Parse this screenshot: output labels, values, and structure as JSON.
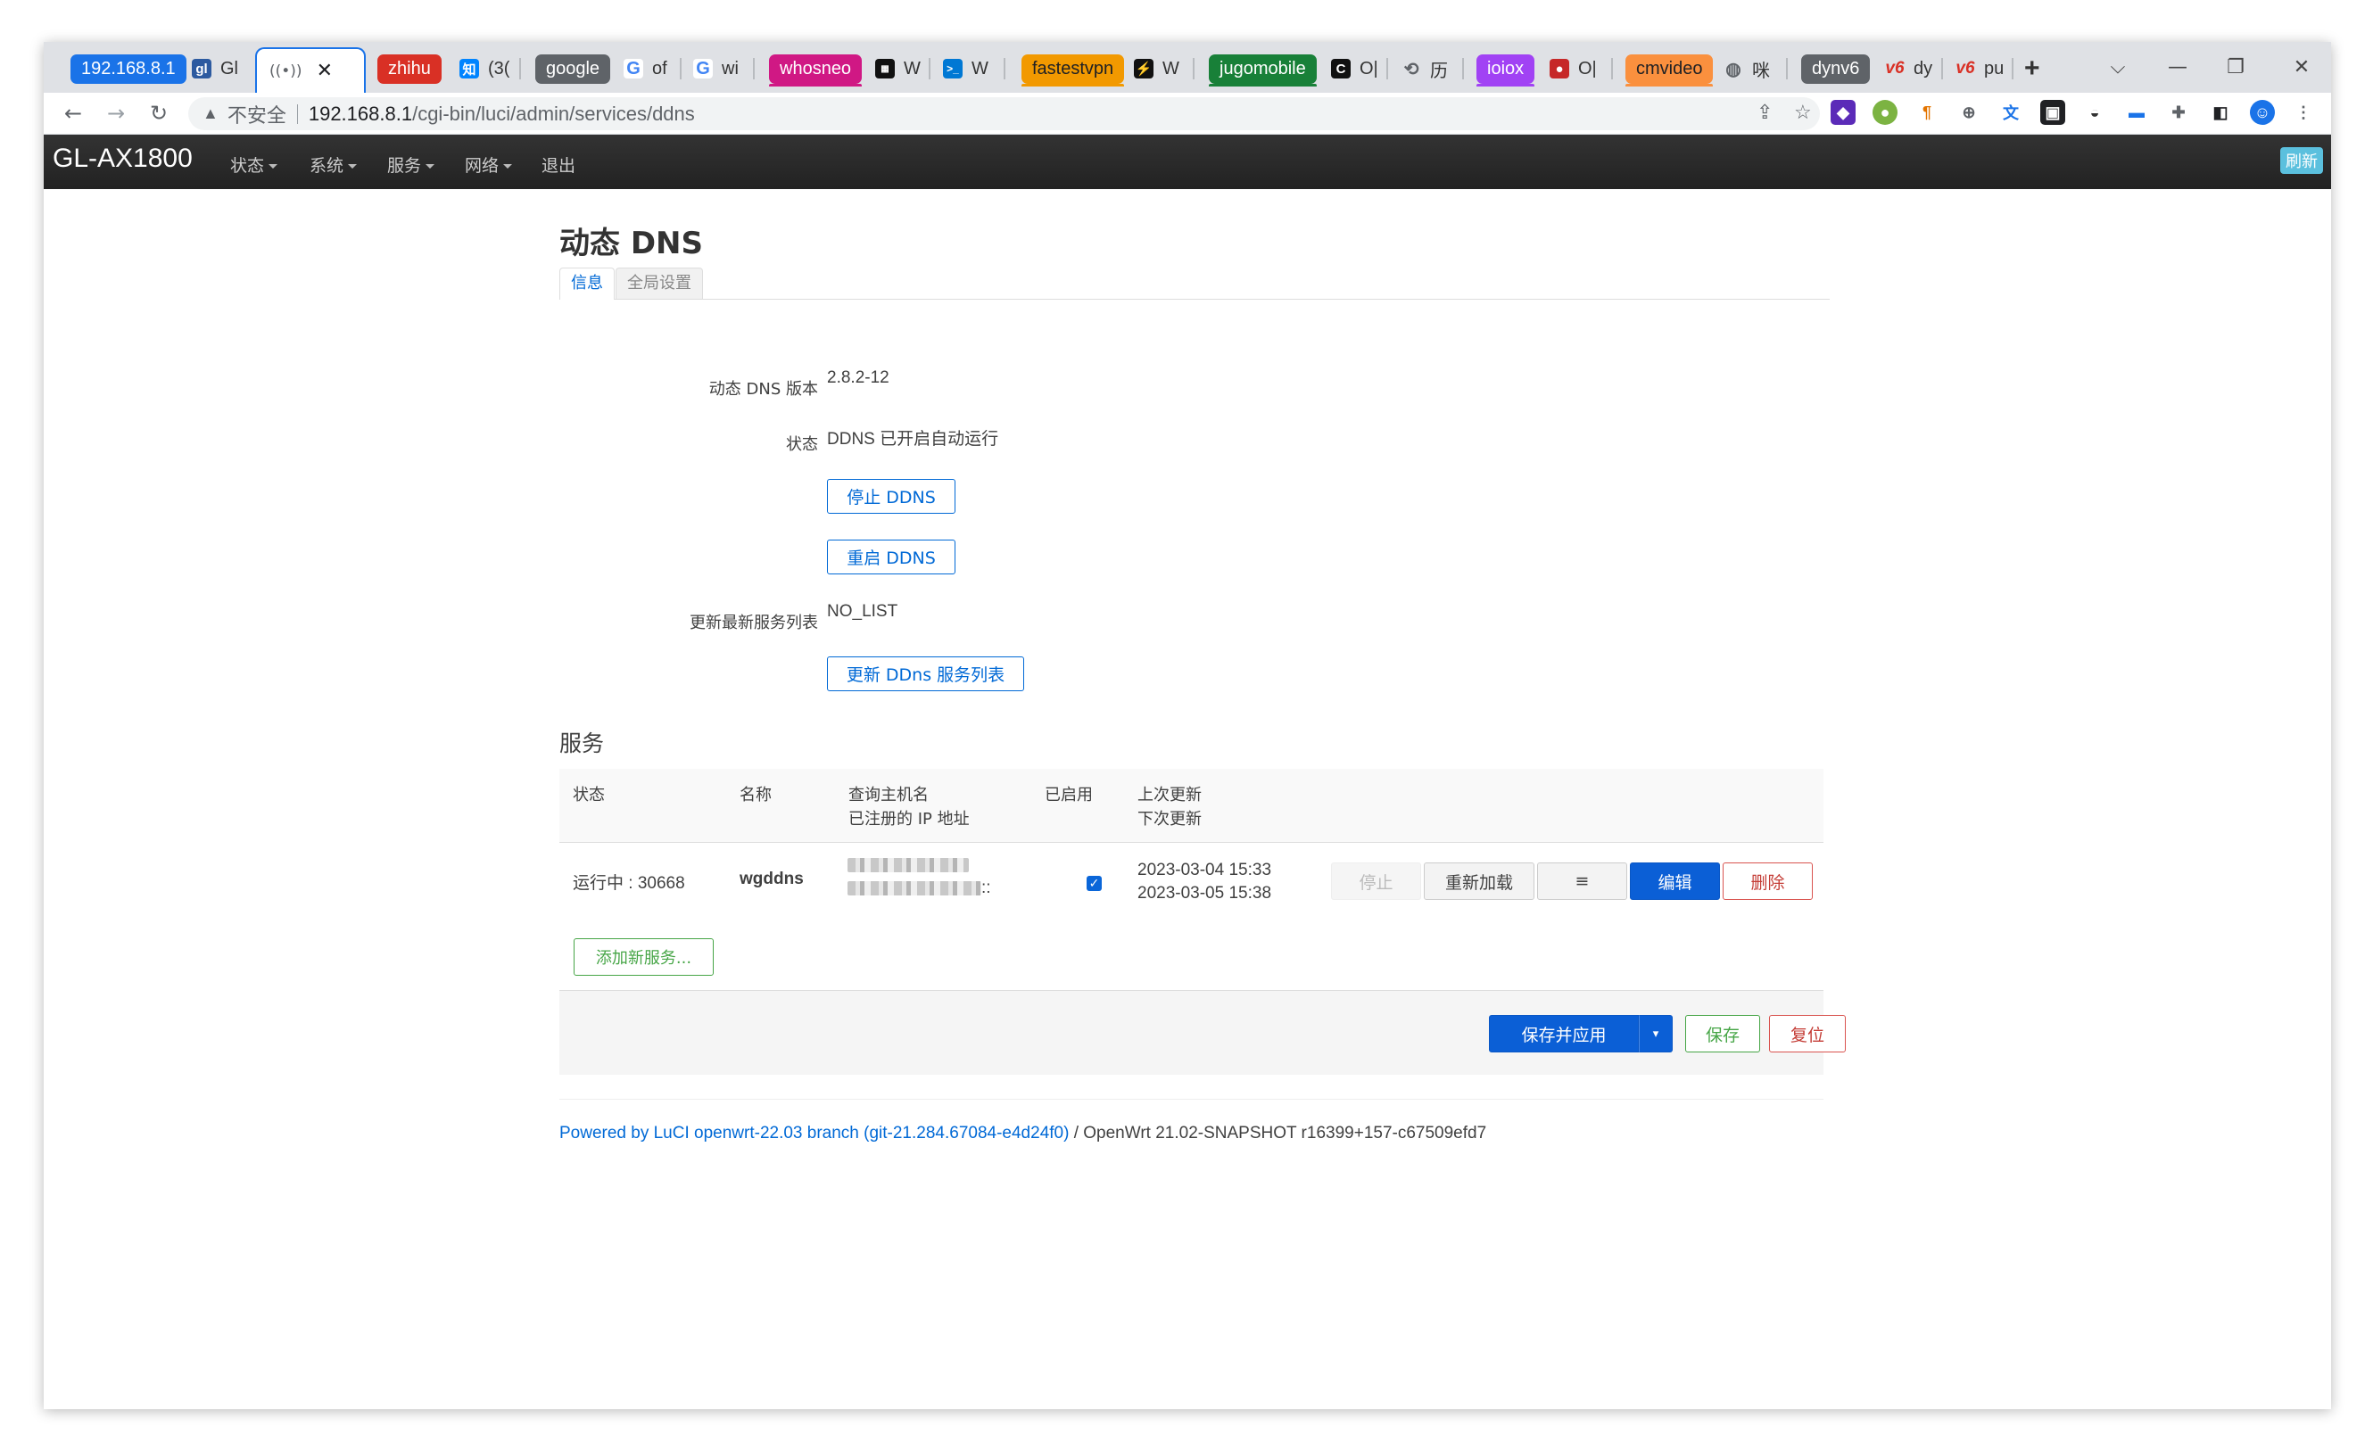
{
  "browser": {
    "tabs": [
      {
        "label": "192.168.8.1",
        "color": "#1a73e8"
      },
      {
        "label": "Gl",
        "favicon": "gl"
      },
      {
        "label": "",
        "favicon": "wifi",
        "active": true
      },
      {
        "label": "zhihu",
        "color": "#d93025"
      },
      {
        "label": "(3(",
        "favicon": "知"
      },
      {
        "label": "google",
        "color": "#5f6368"
      },
      {
        "label": "of",
        "favicon": "G"
      },
      {
        "label": "wi",
        "favicon": "G"
      },
      {
        "label": "whosneo",
        "color": "#d01884"
      },
      {
        "label": "W",
        "favicon": "white"
      },
      {
        "label": "W",
        "favicon": "terminal"
      },
      {
        "label": "fastestvpn",
        "color": "#f29900",
        "text_color": "#202124"
      },
      {
        "label": "W",
        "favicon": "bolt"
      },
      {
        "label": "jugomobile",
        "color": "#188038"
      },
      {
        "label": "O|",
        "favicon": "c"
      },
      {
        "label": "历",
        "favicon": "history"
      },
      {
        "label": "ioiox",
        "color": "#a142f4"
      },
      {
        "label": "O|",
        "favicon": "octo"
      },
      {
        "label": "cmvideo",
        "color": "#fa903e",
        "text_color": "#202124"
      },
      {
        "label": "咪",
        "favicon": "globe"
      },
      {
        "label": "dynv6",
        "color": "#5f6368"
      },
      {
        "label": "dy",
        "favicon": "v6"
      },
      {
        "label": "pu",
        "favicon": "v6"
      }
    ],
    "new_tab": "+",
    "address": {
      "warning": "不安全",
      "host": "192.168.8.1",
      "path": "/cgi-bin/luci/admin/services/ddns"
    }
  },
  "navbar": {
    "brand": "GL-AX1800",
    "menus": [
      "状态",
      "系统",
      "服务",
      "网络",
      "退出"
    ],
    "refresh": "刷新"
  },
  "page": {
    "title": "动态 DNS",
    "tabs": [
      "信息",
      "全局设置"
    ],
    "fields": {
      "version_label": "动态 DNS 版本",
      "version_value": "2.8.2-12",
      "status_label": "状态",
      "status_value": "DDNS 已开启自动运行",
      "stop_button": "停止 DDNS",
      "restart_button": "重启 DDNS",
      "list_label": "更新最新服务列表",
      "list_value": "NO_LIST",
      "update_list_button": "更新 DDns 服务列表"
    },
    "services": {
      "title": "服务",
      "headers": {
        "status": "状态",
        "name": "名称",
        "hostname": "查询主机名",
        "registered_ip": "已注册的 IP 地址",
        "enabled": "已启用",
        "last_update": "上次更新",
        "next_update": "下次更新"
      },
      "rows": [
        {
          "status": "运行中 : 30668",
          "name": "wgddns",
          "ip_suffix": "::",
          "enabled": true,
          "last_update": "2023-03-04 15:33",
          "next_update": "2023-03-05 15:38",
          "buttons": {
            "stop": "停止",
            "reload": "重新加载",
            "menu": "≡",
            "edit": "编辑",
            "delete": "删除"
          }
        }
      ],
      "add_button": "添加新服务..."
    },
    "actions": {
      "save_apply": "保存并应用",
      "save": "保存",
      "reset": "复位"
    },
    "footer": {
      "link_text": "Powered by LuCI openwrt-22.03 branch (git-21.284.67084-e4d24f0)",
      "suffix": " / OpenWrt 21.02-SNAPSHOT r16399+157-c67509efd7"
    }
  },
  "colors": {
    "primary": "#0069d6",
    "success": "#46a546",
    "danger": "#c43c35",
    "navbar": "#222222"
  }
}
